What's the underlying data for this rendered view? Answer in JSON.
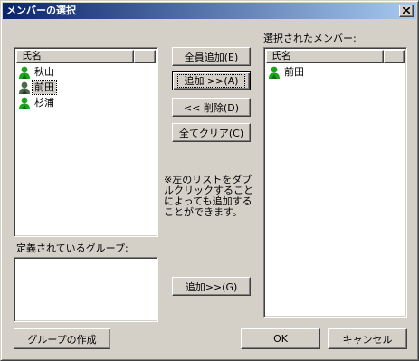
{
  "window": {
    "title": "メンバーの選択",
    "close_label": "×"
  },
  "left_list": {
    "header": "氏名",
    "items": [
      {
        "name": "秋山",
        "icon": "person-green-icon",
        "state": "normal"
      },
      {
        "name": "前田",
        "icon": "person-gray-icon",
        "state": "focused"
      },
      {
        "name": "杉浦",
        "icon": "person-green-icon",
        "state": "normal"
      }
    ]
  },
  "buttons": {
    "add_all": "全員追加(E)",
    "add": "追加 >>(A)",
    "remove": "<< 削除(D)",
    "clear_all": "全てクリア(C)",
    "add_group": "追加>>(G)",
    "create_group": "グループの作成",
    "ok": "OK",
    "cancel": "キャンセル"
  },
  "note": "※左のリストをダブルクリックすることによっても追加することができます。",
  "groups_label": "定義されているグループ:",
  "selected_label": "選択されたメンバー:",
  "right_list": {
    "header": "氏名",
    "items": [
      {
        "name": "前田",
        "icon": "person-green-icon"
      }
    ]
  },
  "colors": {
    "title_start": "#0a246a",
    "title_end": "#a6caf0",
    "person_green": "#1aa51a",
    "person_gray": "#4a6a4a",
    "face": "#d4d0c8"
  }
}
